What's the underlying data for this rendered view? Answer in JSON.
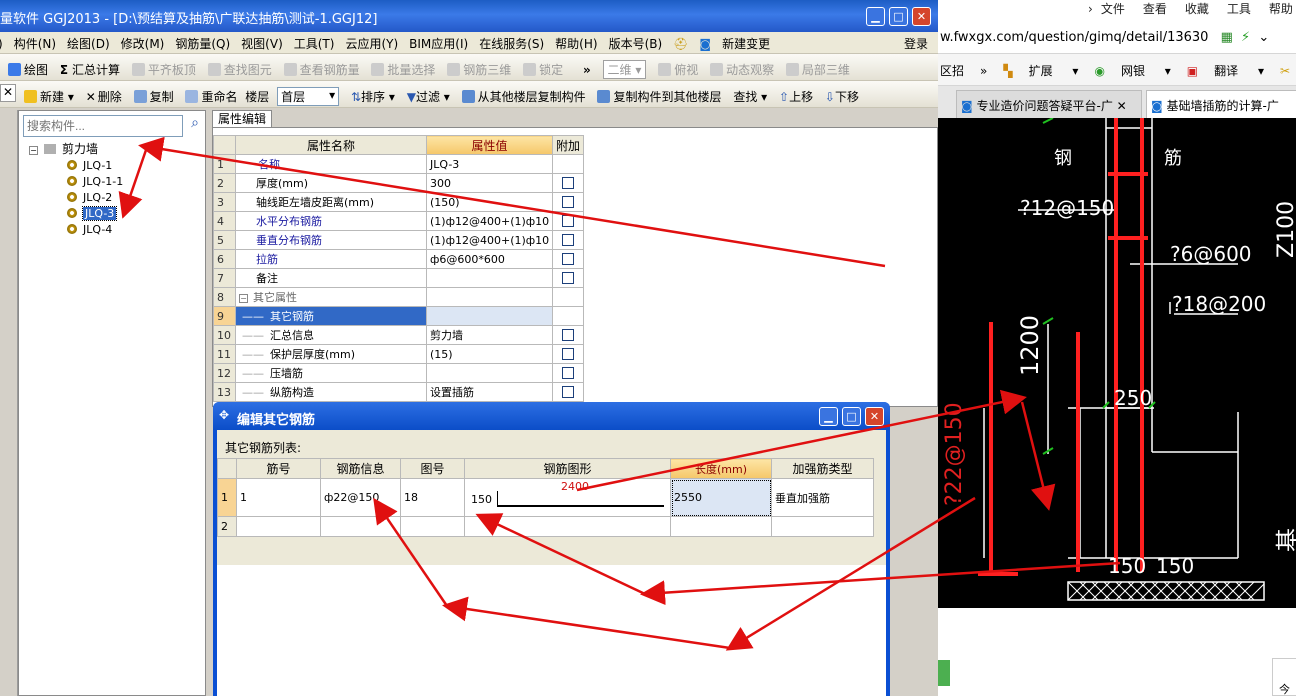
{
  "app": {
    "title": "量软件 GGJ2013 - [D:\\预结算及抽筋\\广联达抽筋\\测试-1.GGJ12]",
    "menu": [
      "构件(N)",
      "绘图(D)",
      "修改(M)",
      "钢筋量(Q)",
      "视图(V)",
      "工具(T)",
      "云应用(Y)",
      "BIM应用(I)",
      "在线服务(S)",
      "帮助(H)",
      "版本号(B)"
    ],
    "menu_new_change": "新建变更",
    "login": "登录",
    "toolbar1": {
      "draw": "绘图",
      "sigma": "Σ",
      "summary": "汇总计算",
      "flush_slab": "平齐板顶",
      "find_element": "查找图元",
      "view_rebar": "查看钢筋量",
      "batch_select": "批量选择",
      "rebar_3d": "钢筋三维",
      "lock": "锁定",
      "more": "»",
      "view_mode": "二维",
      "top_view": "俯视",
      "dynamic_view": "动态观察",
      "local_3d": "局部三维"
    },
    "toolbar2": {
      "new": "新建",
      "delete": "删除",
      "copy": "复制",
      "rename": "重命名",
      "floor_label": "楼层",
      "floor_value": "首层",
      "sort": "排序",
      "filter": "过滤",
      "copy_from_floor": "从其他楼层复制构件",
      "copy_to_floor": "复制构件到其他楼层",
      "find": "查找",
      "move_up": "上移",
      "move_down": "下移"
    },
    "left": {
      "search_placeholder": "搜索构件...",
      "root": "剪力墙",
      "items": [
        "JLQ-1",
        "JLQ-1-1",
        "JLQ-2",
        "JLQ-3",
        "JLQ-4"
      ]
    },
    "prop_tab": "属性编辑",
    "prop_headers": [
      "属性名称",
      "属性值",
      "附加"
    ],
    "props": [
      {
        "n": "1",
        "name": "名称",
        "value": "JLQ-3",
        "cb": false
      },
      {
        "n": "2",
        "name": "厚度(mm)",
        "value": "300",
        "cb": true
      },
      {
        "n": "3",
        "name": "轴线距左墙皮距离(mm)",
        "value": "(150)",
        "cb": true
      },
      {
        "n": "4",
        "name": "水平分布钢筋",
        "value": "(1)ф12@400+(1)ф10",
        "cb": true
      },
      {
        "n": "5",
        "name": "垂直分布钢筋",
        "value": "(1)ф12@400+(1)ф10",
        "cb": true
      },
      {
        "n": "6",
        "name": "拉筋",
        "value": "ф6@600*600",
        "cb": true
      },
      {
        "n": "7",
        "name": "备注",
        "value": "",
        "cb": true
      },
      {
        "n": "8",
        "name": "其它属性",
        "value": "",
        "cb": false
      },
      {
        "n": "9",
        "name": "其它钢筋",
        "value": "",
        "cb": false
      },
      {
        "n": "10",
        "name": "汇总信息",
        "value": "剪力墙",
        "cb": true
      },
      {
        "n": "11",
        "name": "保护层厚度(mm)",
        "value": "(15)",
        "cb": true
      },
      {
        "n": "12",
        "name": "压墙筋",
        "value": "",
        "cb": true
      },
      {
        "n": "13",
        "name": "纵筋构造",
        "value": "设置插筋",
        "cb": true
      }
    ],
    "dialog": {
      "title": "编辑其它钢筋",
      "list_label": "其它钢筋列表:",
      "headers": [
        "筋号",
        "钢筋信息",
        "图号",
        "钢筋图形",
        "长度(mm)",
        "加强筋类型"
      ],
      "row1": {
        "n": "1",
        "no": "1",
        "info": "ф22@150",
        "fig": "18",
        "shape_left": "150",
        "shape_top": "2400",
        "length": "2550",
        "type": "垂直加强筋"
      },
      "row2_n": "2"
    }
  },
  "browser": {
    "menu": [
      "文件",
      "查看",
      "收藏",
      "工具",
      "帮助"
    ],
    "url": "w.fwxgx.com/question/gimq/detail/13630",
    "fav": [
      "区招",
      "»",
      "扩展",
      "网银",
      "翻译",
      "截图"
    ],
    "tabs": [
      "专业造价问题答疑平台-广",
      "基础墙插筋的计算-广"
    ],
    "cad": {
      "t1": "钢",
      "t2": "筋",
      "t3": "?12@150",
      "t4": "?6@600",
      "t5": "?18@200",
      "t6": "1200",
      "t7": "250",
      "t8": "?22@150",
      "t9": "150",
      "t10": "150",
      "t11": "基础高",
      "t12": "Z100"
    },
    "bottom_text": "今"
  },
  "colors": {
    "arrow": "#e01010",
    "title_blue": "#1d5dc4",
    "selected": "#3169c6",
    "cad_red": "#ff2020"
  }
}
